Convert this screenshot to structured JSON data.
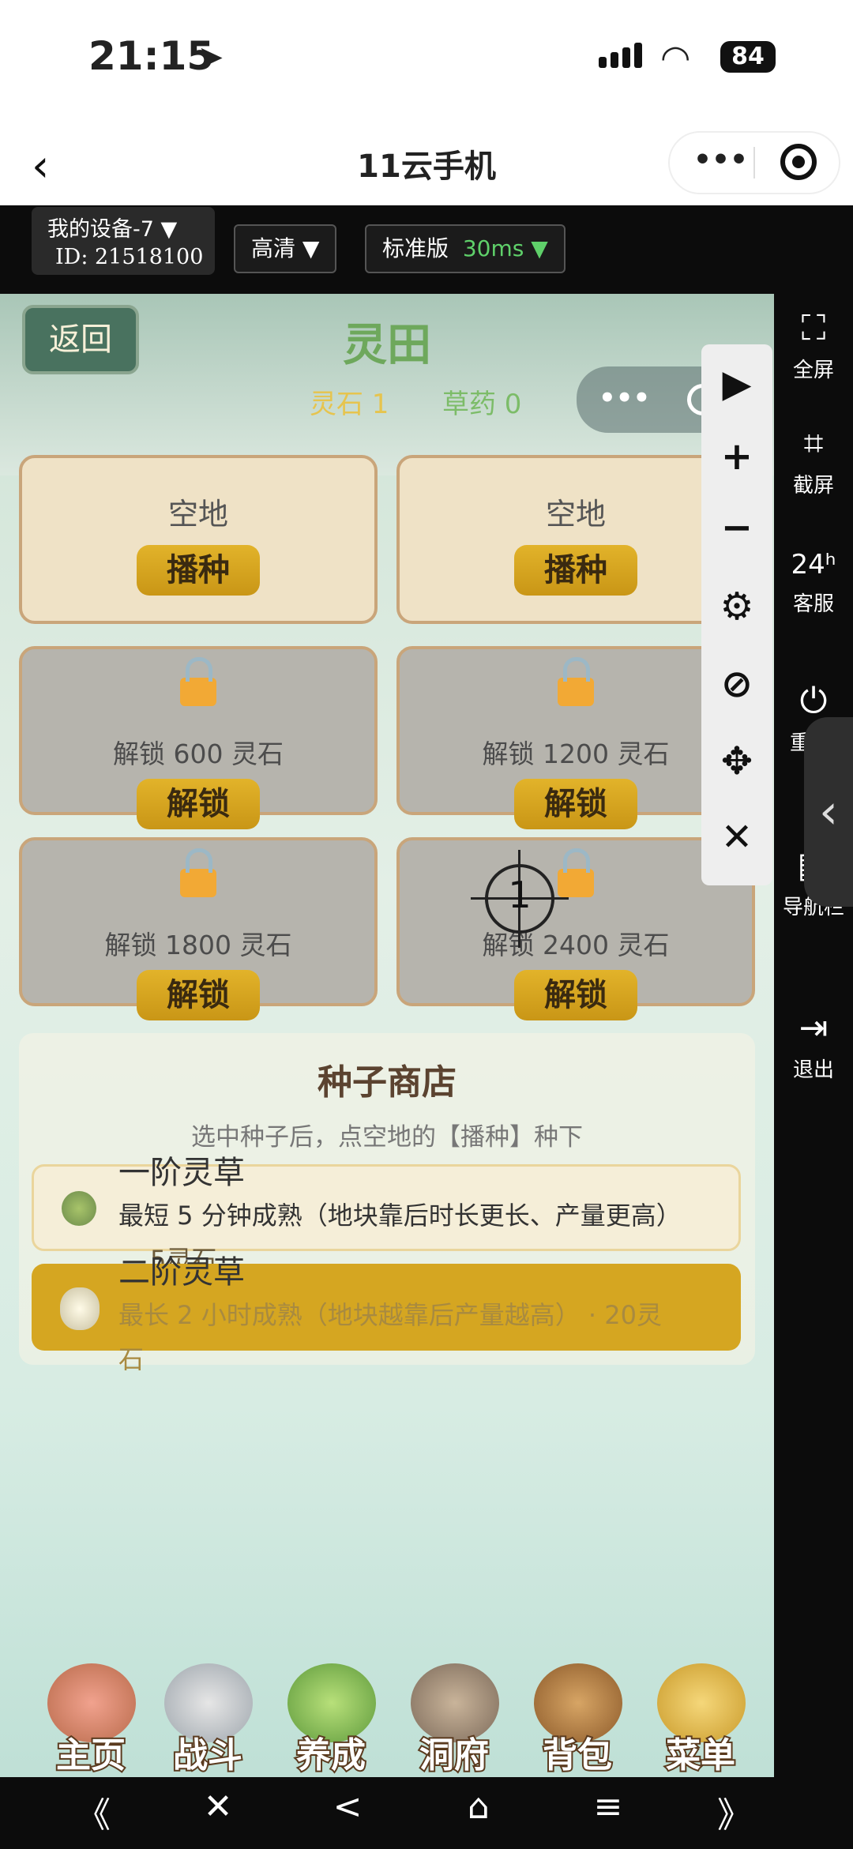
{
  "status_bar": {
    "time": "21:15",
    "battery": "84"
  },
  "nav_bar": {
    "title": "11云手机"
  },
  "device": {
    "name": "我的设备-7 ▼",
    "id": "ID: 21518100"
  },
  "quality": {
    "label": "高清 ▼"
  },
  "version": {
    "label": "标准版",
    "latency": "30ms ▼"
  },
  "game": {
    "back_label": "返回",
    "title": "灵田",
    "resources": [
      {
        "label": "灵石 1"
      },
      {
        "label": "草药 0"
      }
    ],
    "plots": [
      {
        "status": "空地",
        "button": "播种"
      },
      {
        "status": "空地",
        "button": "播种"
      },
      {
        "status": "解锁 600 灵石",
        "button": "解锁"
      },
      {
        "status": "解锁 1200 灵石",
        "button": "解锁"
      },
      {
        "status": "解锁 1800 灵石",
        "button": "解锁"
      },
      {
        "status": "解锁 2400 灵石",
        "button": "解锁"
      }
    ],
    "seed_shop": {
      "title": "种子商店",
      "hint": "选中种子后，点空地的【播种】种下",
      "seeds": [
        {
          "name": "一阶灵草",
          "desc": "最短 5 分钟成熟（地块靠后时长更长、产量更高）",
          "price": "5灵石"
        },
        {
          "name": "二阶灵草",
          "desc": "最长 2 小时成熟（地块越靠后产量越高） · 20灵",
          "price": "石"
        }
      ]
    },
    "bottom_nav": [
      {
        "label": "主页"
      },
      {
        "label": "战斗"
      },
      {
        "label": "养成"
      },
      {
        "label": "洞府"
      },
      {
        "label": "背包"
      },
      {
        "label": "菜单"
      }
    ],
    "crosshair_number": "1"
  },
  "sidebar": [
    {
      "label": "全屏",
      "icon": "fullscreen-icon"
    },
    {
      "label": "截屏",
      "icon": "crop-icon"
    },
    {
      "label": "客服",
      "icon": "support-24h-icon"
    },
    {
      "label": "重",
      "icon": "restart-icon"
    },
    {
      "label": "导航栏",
      "icon": "navbar-icon"
    },
    {
      "label": "退出",
      "icon": "exit-icon"
    }
  ],
  "tools": [
    "play-icon",
    "plus-icon",
    "minus-icon",
    "gear-icon",
    "eye-off-icon",
    "move-icon",
    "close-icon"
  ],
  "android_nav": [
    "《",
    "✕",
    "<",
    "⌂",
    "≡",
    "》"
  ],
  "colors": {
    "accent_gold": "#d5a621",
    "title_green": "#6ea85c",
    "latency_green": "#5fd06a"
  }
}
